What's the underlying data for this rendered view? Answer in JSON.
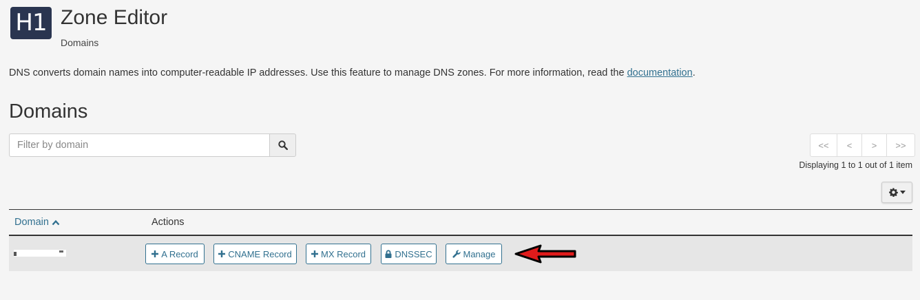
{
  "header": {
    "logo_text": "H1",
    "title": "Zone Editor",
    "subtitle": "Domains"
  },
  "description": {
    "text": "DNS converts domain names into computer-readable IP addresses. Use this feature to manage DNS zones. For more information, read the ",
    "link": "documentation",
    "suffix": "."
  },
  "section_title": "Domains",
  "search": {
    "placeholder": "Filter by domain",
    "value": "",
    "icon": "search-icon"
  },
  "pagination": {
    "first": "<<",
    "prev": "<",
    "next": ">",
    "last": ">>",
    "summary": "Displaying 1 to 1 out of 1 item"
  },
  "settings_button": {
    "icon": "gear-icon"
  },
  "table": {
    "columns": [
      {
        "label": "Domain",
        "sort": "ascending"
      },
      {
        "label": "Actions"
      }
    ],
    "rows": [
      {
        "domain": "",
        "actions": [
          {
            "label": "A Record",
            "icon": "plus-icon"
          },
          {
            "label": "CNAME Record",
            "icon": "plus-icon"
          },
          {
            "label": "MX Record",
            "icon": "plus-icon"
          },
          {
            "label": "DNSSEC",
            "icon": "lock-icon"
          },
          {
            "label": "Manage",
            "icon": "wrench-icon"
          }
        ]
      }
    ]
  },
  "colors": {
    "accent": "#31708f",
    "logo_bg": "#2a3550",
    "annotation_arrow": "#e01b1b"
  }
}
